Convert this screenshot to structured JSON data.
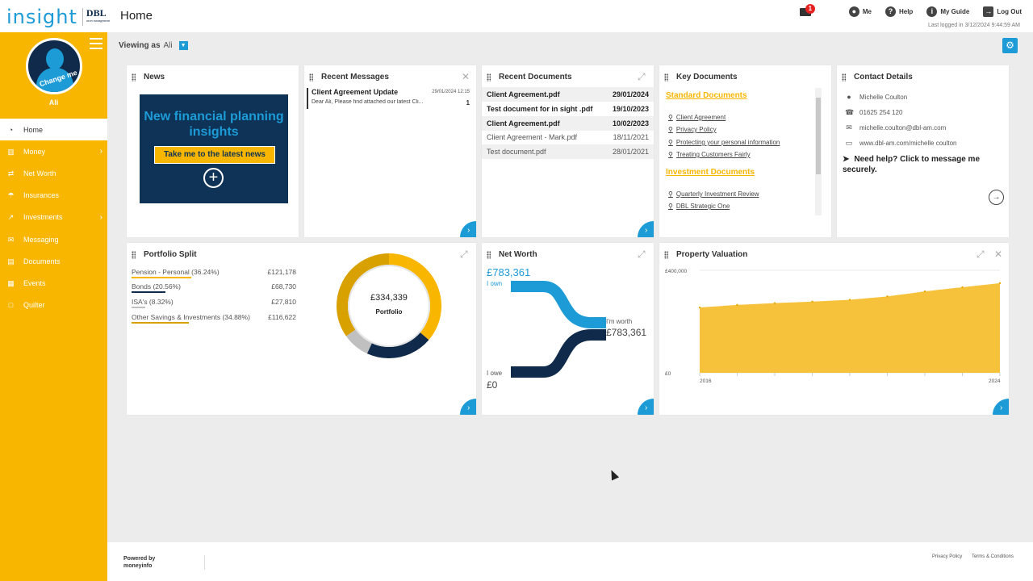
{
  "header": {
    "logo_text": "insight",
    "logo_brand": "DBL",
    "logo_brand_sub": "asset management",
    "page_title": "Home",
    "notifications_count": "1",
    "nav": [
      {
        "label": "Me",
        "icon": "user-circle-icon"
      },
      {
        "label": "Help",
        "icon": "help-icon"
      },
      {
        "label": "My Guide",
        "icon": "info-icon"
      },
      {
        "label": "Log Out",
        "icon": "logout-icon"
      }
    ],
    "last_logged": "Last logged in 3/12/2024 9:44:59 AM"
  },
  "sidebar": {
    "change_me": "Change me",
    "username": "Ali",
    "items": [
      {
        "label": "Home",
        "icon": "dashboard-icon",
        "active": true
      },
      {
        "label": "Money",
        "icon": "bank-icon",
        "has_children": true
      },
      {
        "label": "Net Worth",
        "icon": "exchange-icon"
      },
      {
        "label": "Insurances",
        "icon": "umbrella-icon"
      },
      {
        "label": "Investments",
        "icon": "chart-icon",
        "has_children": true
      },
      {
        "label": "Messaging",
        "icon": "envelope-icon"
      },
      {
        "label": "Documents",
        "icon": "document-icon"
      },
      {
        "label": "Events",
        "icon": "calendar-icon"
      },
      {
        "label": "Quilter",
        "icon": "square-icon"
      }
    ]
  },
  "viewing": {
    "label": "Viewing as",
    "value": "Ali"
  },
  "news": {
    "title": "News",
    "headline": "New financial planning insights",
    "button": "Take me to the latest news"
  },
  "messages": {
    "title": "Recent Messages",
    "items": [
      {
        "subject": "Client Agreement Update",
        "date": "29/01/2024 12:15",
        "preview": "Dear Ali,    Please find attached our latest Cli...",
        "count": "1"
      }
    ]
  },
  "documents": {
    "title": "Recent Documents",
    "items": [
      {
        "name": "Client Agreement.pdf",
        "date": "29/01/2024",
        "unread": true
      },
      {
        "name": "Test document for in sight .pdf",
        "date": "19/10/2023",
        "unread": true
      },
      {
        "name": "Client Agreement.pdf",
        "date": "10/02/2023",
        "unread": true
      },
      {
        "name": "Client Agreement - Mark.pdf",
        "date": "18/11/2021",
        "unread": false
      },
      {
        "name": "Test document.pdf",
        "date": "28/01/2021",
        "unread": false
      }
    ]
  },
  "key_documents": {
    "title": "Key Documents",
    "sections": [
      {
        "heading": "Standard Documents",
        "links": [
          "Client Agreement",
          "Privacy Policy",
          "Protecting your personal information",
          "Treating Customers Fairly"
        ]
      },
      {
        "heading": "Investment Documents",
        "links": [
          "Quarterly Investment Review",
          "DBL Strategic One"
        ]
      }
    ]
  },
  "contact": {
    "title": "Contact Details",
    "name": "Michelle Coulton",
    "phone": "01625 254 120",
    "email": "michelle.coulton@dbl-am.com",
    "web": "www.dbl-am.com/michelle coulton",
    "help": "Need help? Click to message me securely."
  },
  "portfolio": {
    "title": "Portfolio Split",
    "total": "£334,339",
    "total_label": "Portfolio",
    "rows": [
      {
        "label": "Pension - Personal (36.24%)",
        "value": "£121,178",
        "pct": 36.24,
        "color": "#f8b600"
      },
      {
        "label": "Bonds (20.56%)",
        "value": "£68,730",
        "pct": 20.56,
        "color": "#0f2a4a"
      },
      {
        "label": "ISA's (8.32%)",
        "value": "£27,810",
        "pct": 8.32,
        "color": "#c0c0c0"
      },
      {
        "label": "Other Savings & Investments (34.88%)",
        "value": "£116,622",
        "pct": 34.88,
        "color": "#d9a100"
      }
    ]
  },
  "networth": {
    "title": "Net Worth",
    "own_value": "£783,361",
    "own_label": "I own",
    "worth_label": "I'm worth",
    "worth_value": "£783,361",
    "owe_label": "I owe",
    "owe_value": "£0",
    "colors": {
      "own": "#1c9bd7",
      "owe": "#0f2a4a"
    }
  },
  "property": {
    "title": "Property Valuation",
    "chart_data": {
      "type": "area",
      "x": [
        "2016",
        "2017",
        "2018",
        "2019",
        "2020",
        "2021",
        "2022",
        "2023",
        "2024"
      ],
      "values": [
        255000,
        265000,
        272000,
        278000,
        285000,
        298000,
        318000,
        334000,
        350000
      ],
      "ylim": [
        0,
        400000
      ],
      "ytick_labels": [
        "£400,000",
        "£0"
      ],
      "xtick_labels": [
        "2016",
        "2024"
      ],
      "color": "#f7c23b"
    }
  },
  "footer": {
    "powered": "Powered by",
    "powered_brand": "moneyinfo",
    "links": [
      "Privacy Policy",
      "Terms & Conditions"
    ]
  }
}
